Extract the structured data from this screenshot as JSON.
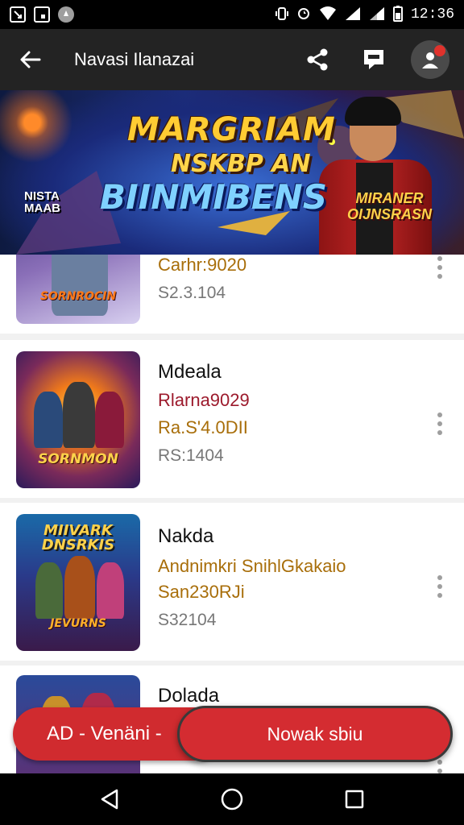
{
  "status_bar": {
    "left_icons": [
      "screenshot-icon",
      "download-icon",
      "notification-icon"
    ],
    "time": "12:36"
  },
  "toolbar": {
    "title": "Navasi Ilanazai",
    "icons": [
      "back-arrow-icon",
      "share-icon",
      "chat-icon",
      "account-icon"
    ]
  },
  "banner": {
    "line1": "MARGRIAM",
    "line2": "NSKBP AN",
    "line3": "BIINMIBENS",
    "left_small": "NISTA\nMAAB",
    "badge": "MIRANER\nOIJNSRASN"
  },
  "list": {
    "items": [
      {
        "thumb_label": "SORNROCIN",
        "title": "",
        "line_red": "",
        "line_gold": "Carhr:9020",
        "price": "S2.3.104"
      },
      {
        "thumb_label": "SORNMON",
        "title": "Mdeala",
        "line_red": "Rlarna9029",
        "line_gold": "Ra.S'4.0DII",
        "price": "RS:1404"
      },
      {
        "thumb_top": "MIIVARK\nDNSRKIS",
        "thumb_label": "JEVURNS",
        "title": "Nakda",
        "line_red": "Andnimkri SnihlGkakaio",
        "line_gold": "San230RJi",
        "price": "S32104"
      },
      {
        "thumb_label": "",
        "title": "Dolada",
        "line_red": "",
        "line_gold": "",
        "price": ""
      }
    ]
  },
  "bottom_actions": {
    "left_label": "AD - Venäni -",
    "right_label": "Nowak sbiu"
  },
  "navbar": {
    "icons": [
      "back-triangle-icon",
      "home-circle-icon",
      "recents-square-icon"
    ]
  },
  "colors": {
    "accent_red": "#d42c31",
    "toolbar_bg": "#232323",
    "price_red": "#9c1a2c",
    "price_gold": "#a86e0a"
  }
}
